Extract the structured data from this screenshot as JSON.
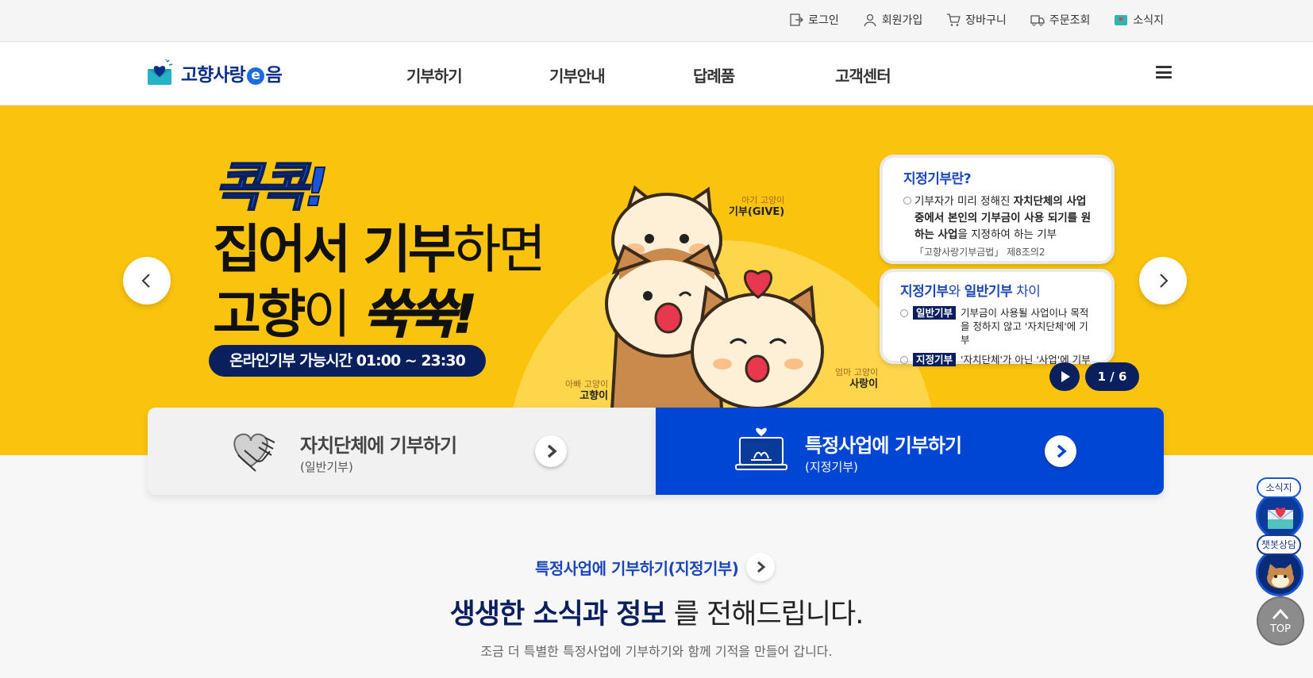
{
  "util_links": [
    "로그인",
    "회원가입",
    "장바구니",
    "주문조회",
    "소식지"
  ],
  "logo": {
    "part1": "고향사랑",
    "e": "e",
    "part2": "음"
  },
  "menu": [
    "기부하기",
    "기부안내",
    "답례품",
    "고객센터"
  ],
  "hero": {
    "kicker": "콕콕!",
    "line1_bold": "집어서 기부",
    "line1_light": "하면",
    "line2_bold": "고향",
    "line2_light": "이",
    "line2_ital": "쑥쑥!",
    "hours": "온라인기부 가능시간 01:00 ~ 23:30",
    "cats": [
      {
        "sub": "아기 고양이",
        "name": "기부(GIVE)"
      },
      {
        "sub": "아빠 고양이",
        "name": "고향이"
      },
      {
        "sub": "엄마 고양이",
        "name": "사랑이"
      }
    ],
    "card1": {
      "title": "지정기부란?",
      "t1": "기부자가 미리 정해진 ",
      "b1": "자치단체의 사업 중에서 본인의 기부금이 사용 되기를 원하는 사업",
      "t2": "을 지정하여 하는 기부",
      "cite": "「고향사랑기부금법」 제8조의2"
    },
    "card2": {
      "title_b1": "지정기부",
      "title_n1": "와 ",
      "title_b2": "일반기부",
      "title_n2": " 차이",
      "row1_tag": "일반기부",
      "row1_text": "기부금이 사용될 사업이나 목적을 정하지 않고 '자치단체'에 기부",
      "row2_tag": "지정기부",
      "row2_text": "'자치단체'가 아닌 '사업'에 기부"
    },
    "slide_counter": "1 / 6"
  },
  "donate": {
    "general": {
      "title": "자치단체에 기부하기",
      "sub": "(일반기부)"
    },
    "specific": {
      "title": "특정사업에 기부하기",
      "sub": "(지정기부)"
    }
  },
  "section": {
    "link": "특정사업에 기부하기(지정기부)",
    "title_bold": "생생한 소식과 정보",
    "title_rest": "를 전해드립니다.",
    "desc": "조금 더 특별한 특정사업에 기부하기와 함께 기적을 만들어 갑니다."
  },
  "floats": {
    "news": "소식지",
    "chat": "챗봇상담",
    "top": "TOP"
  },
  "colors": {
    "hero_yellow": "#fac40e",
    "navy": "#0a1f5e",
    "brand_blue": "#0046d5"
  }
}
